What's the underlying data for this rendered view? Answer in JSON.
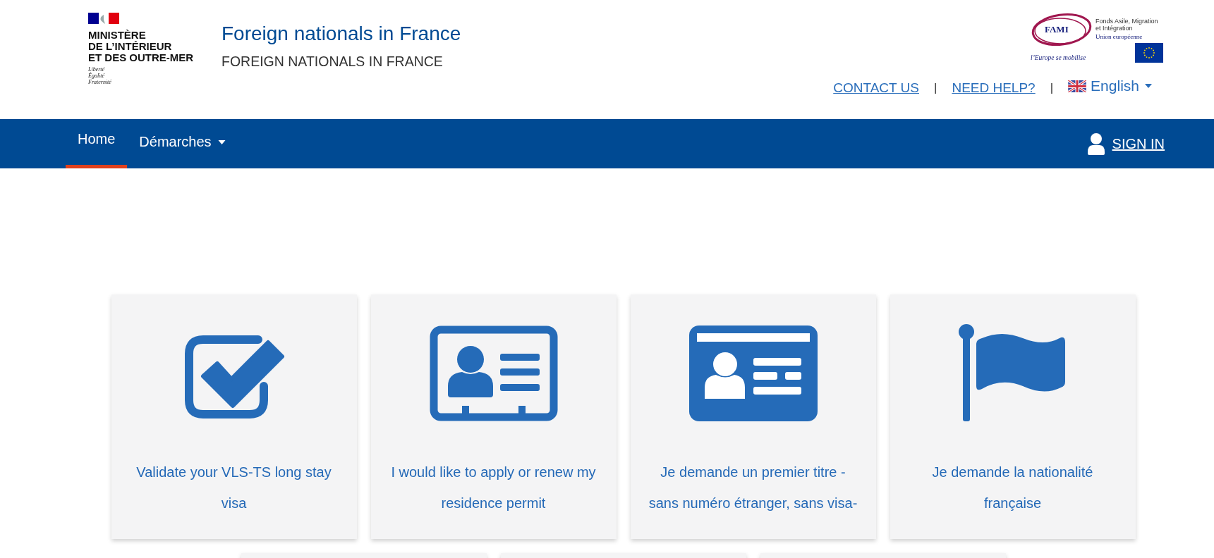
{
  "header": {
    "ministry_logo": {
      "lines": [
        "MINISTÈRE",
        "DE L’INTÉRIEUR",
        "ET DES OUTRE-MER"
      ],
      "motto": [
        "Liberté",
        "Égalité",
        "Fraternité"
      ]
    },
    "title": "Foreign nationals in France",
    "subtitle": "FOREIGN NATIONALS IN FRANCE",
    "fami_logo": {
      "name": "FAMI",
      "fund": "Fonds Asile, Migration et Intégration",
      "union": "Union européenne",
      "slogan": "l’Europe se mobilise"
    },
    "links": [
      {
        "kind": "link",
        "label": "CONTACT US"
      },
      {
        "kind": "separator",
        "label": "|"
      },
      {
        "kind": "link",
        "label": "NEED HELP?"
      },
      {
        "kind": "separator",
        "label": "|"
      },
      {
        "kind": "language",
        "label": "English"
      }
    ]
  },
  "nav": {
    "items": [
      {
        "label": "Home",
        "selected": true,
        "dropdown": false
      },
      {
        "label": "Démarches",
        "selected": false,
        "dropdown": true
      }
    ],
    "sign_in": "SIGN IN"
  },
  "cards": [
    {
      "kind": "checkbox",
      "label": "Validate your VLS-TS long stay visa"
    },
    {
      "kind": "badge",
      "label": "I would like to apply or renew my residence permit"
    },
    {
      "kind": "idcard",
      "label": "Je demande un premier titre -sans numéro étranger, sans visa-"
    },
    {
      "kind": "flag",
      "label": "Je demande la nationalité française"
    }
  ]
}
